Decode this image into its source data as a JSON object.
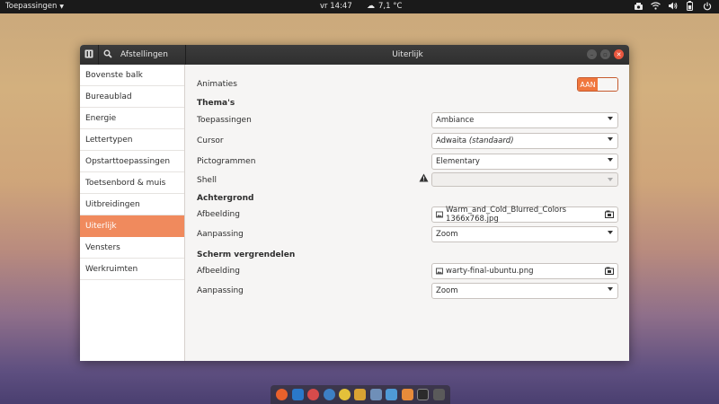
{
  "topbar": {
    "apps_label": "Toepassingen",
    "clock": "vr 14:47",
    "weather": "7,1 °C"
  },
  "window": {
    "sidebar_title": "Afstellingen",
    "title": "Uiterlijk"
  },
  "sidebar": {
    "items": [
      {
        "label": "Bovenste balk"
      },
      {
        "label": "Bureaublad"
      },
      {
        "label": "Energie"
      },
      {
        "label": "Lettertypen"
      },
      {
        "label": "Opstarttoepassingen"
      },
      {
        "label": "Toetsenbord & muis"
      },
      {
        "label": "Uitbreidingen"
      },
      {
        "label": "Uiterlijk"
      },
      {
        "label": "Vensters"
      },
      {
        "label": "Werkruimten"
      }
    ],
    "active_index": 7
  },
  "content": {
    "animations_label": "Animaties",
    "animations_toggle": "AAN",
    "themes_heading": "Thema's",
    "applications_label": "Toepassingen",
    "applications_value": "Ambiance",
    "cursor_label": "Cursor",
    "cursor_value": "Adwaita",
    "cursor_value_suffix": "(standaard)",
    "icons_label": "Pictogrammen",
    "icons_value": "Elementary",
    "shell_label": "Shell",
    "shell_value": "",
    "background_heading": "Achtergrond",
    "bg_image_label": "Afbeelding",
    "bg_image_value": "Warm_and_Cold_Blurred_Colors 1366x768.jpg",
    "bg_adjust_label": "Aanpassing",
    "bg_adjust_value": "Zoom",
    "lock_heading": "Scherm vergrendelen",
    "lock_image_label": "Afbeelding",
    "lock_image_value": "warty-final-ubuntu.png",
    "lock_adjust_label": "Aanpassing",
    "lock_adjust_value": "Zoom"
  },
  "colors": {
    "accent": "#f08a5d",
    "toggle_on": "#f0773d",
    "close_button": "#e9573f",
    "titlebar": "#333333"
  }
}
